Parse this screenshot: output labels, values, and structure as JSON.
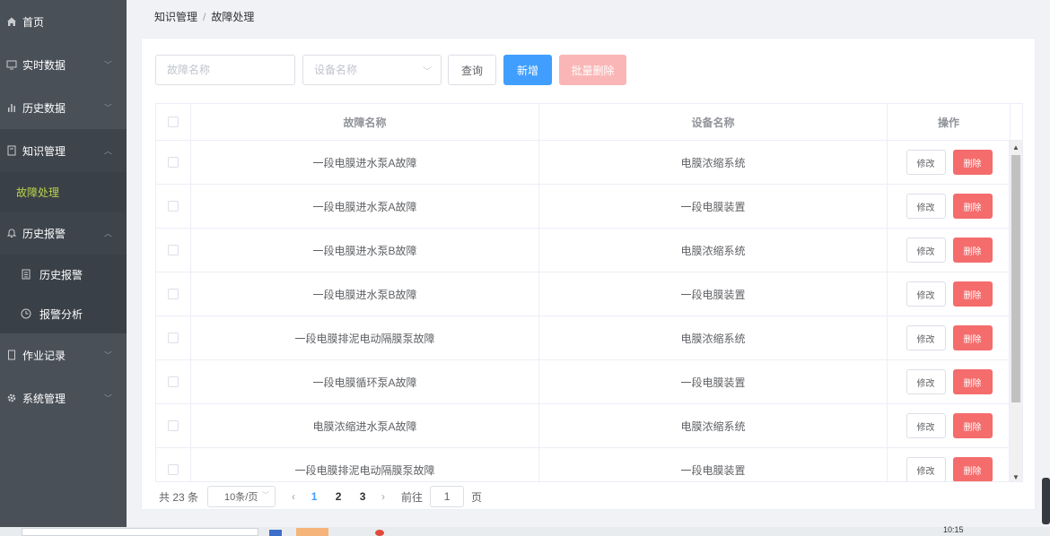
{
  "sidebar": {
    "items": [
      {
        "label": "首页",
        "icon": "home-icon",
        "has_arrow": false
      },
      {
        "label": "实时数据",
        "icon": "monitor-icon",
        "has_arrow": true
      },
      {
        "label": "历史数据",
        "icon": "bar-chart-icon",
        "has_arrow": true
      },
      {
        "label": "知识管理",
        "icon": "book-icon",
        "has_arrow": true,
        "open": true,
        "children": [
          {
            "label": "故障处理",
            "active": true
          }
        ]
      },
      {
        "label": "历史报警",
        "icon": "bell-icon",
        "has_arrow": true,
        "open": true,
        "children": [
          {
            "label": "历史报警",
            "icon": "document-icon"
          },
          {
            "label": "报警分析",
            "icon": "clock-icon"
          }
        ]
      },
      {
        "label": "作业记录",
        "icon": "notebook-icon",
        "has_arrow": true
      },
      {
        "label": "系统管理",
        "icon": "gear-icon",
        "has_arrow": true
      }
    ]
  },
  "breadcrumb": {
    "parent": "知识管理",
    "separator": "/",
    "current": "故障处理"
  },
  "toolbar": {
    "fault_name_placeholder": "故障名称",
    "device_name_placeholder": "设备名称",
    "query_label": "查询",
    "add_label": "新增",
    "batch_delete_label": "批量删除"
  },
  "table": {
    "headers": {
      "fault_name": "故障名称",
      "device_name": "设备名称",
      "operation": "操作"
    },
    "rows": [
      {
        "fault_name": "一段电膜进水泵A故障",
        "device_name": "电膜浓缩系统"
      },
      {
        "fault_name": "一段电膜进水泵A故障",
        "device_name": "一段电膜装置"
      },
      {
        "fault_name": "一段电膜进水泵B故障",
        "device_name": "电膜浓缩系统"
      },
      {
        "fault_name": "一段电膜进水泵B故障",
        "device_name": "一段电膜装置"
      },
      {
        "fault_name": "一段电膜排泥电动隔膜泵故障",
        "device_name": "电膜浓缩系统"
      },
      {
        "fault_name": "一段电膜循环泵A故障",
        "device_name": "一段电膜装置"
      },
      {
        "fault_name": "电膜浓缩进水泵A故障",
        "device_name": "电膜浓缩系统"
      },
      {
        "fault_name": "一段电膜排泥电动隔膜泵故障",
        "device_name": "一段电膜装置"
      }
    ],
    "edit_label": "修改",
    "delete_label": "删除"
  },
  "pagination": {
    "total_text": "共 23 条",
    "page_size": "10条/页",
    "pages": [
      "1",
      "2",
      "3"
    ],
    "current_page": "1",
    "goto_label": "前往",
    "goto_value": "1",
    "page_unit": "页"
  },
  "taskbar": {
    "time": "10:15"
  },
  "colors": {
    "primary": "#409eff",
    "danger": "#f56c6c",
    "danger_disabled": "#fab6b6",
    "sidebar_bg": "#4a5058",
    "active_menu": "#b8d34c"
  }
}
